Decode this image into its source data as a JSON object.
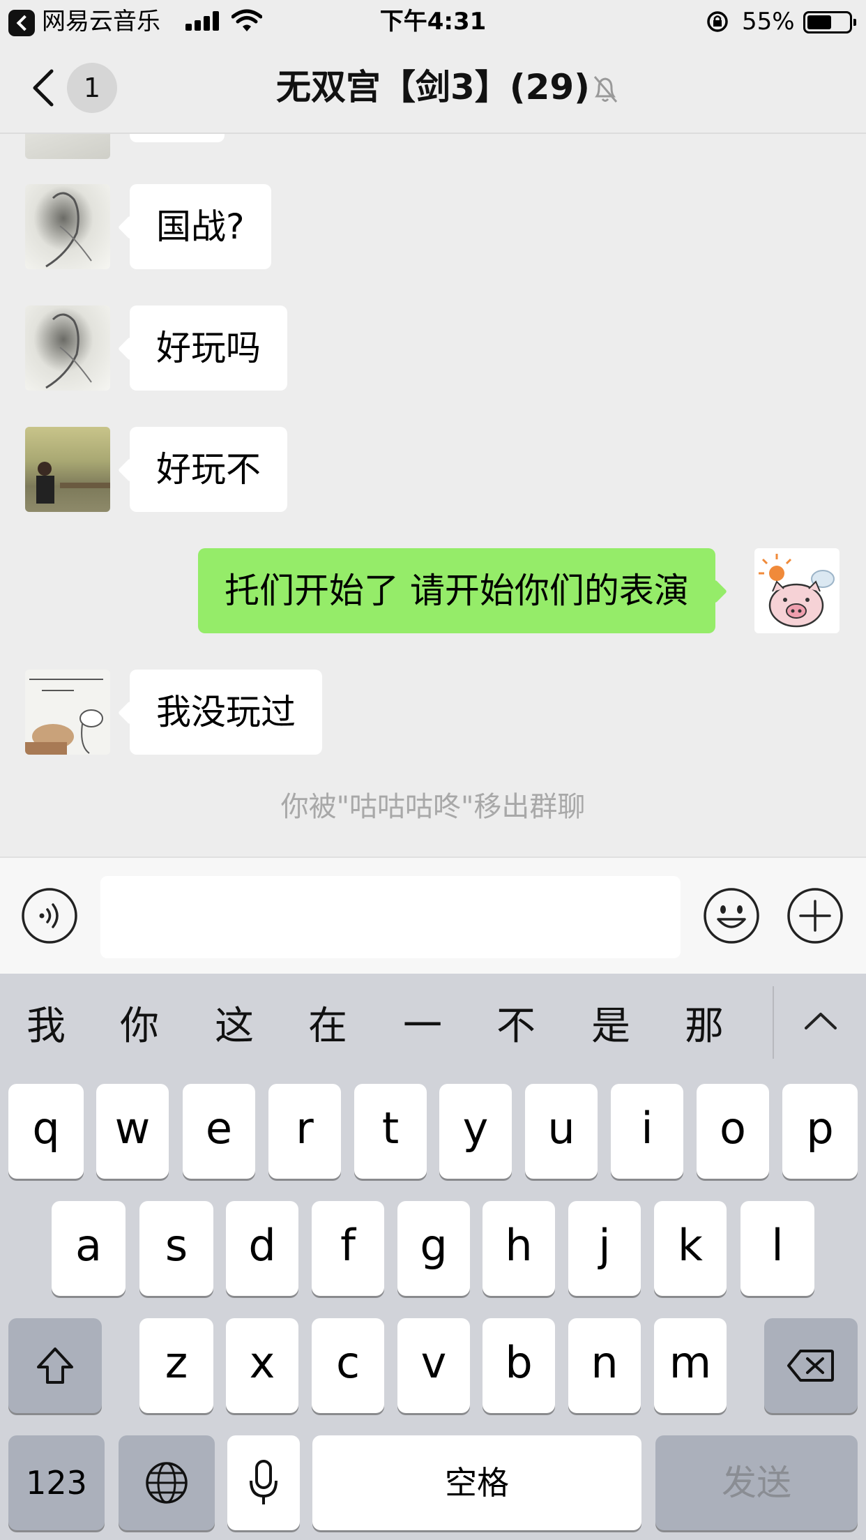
{
  "status_bar": {
    "back_app": "网易云音乐",
    "time": "下午4:31",
    "battery": "55%"
  },
  "nav": {
    "unread_count": "1",
    "title": "无双宫【剑3】(29)"
  },
  "messages": [
    {
      "text": "国战?"
    },
    {
      "text": "好玩吗"
    },
    {
      "text": "好玩不"
    },
    {
      "text": "托们开始了 请开始你们的表演"
    },
    {
      "text": "我没玩过"
    }
  ],
  "system_notice": "你被\"咕咕咕咚\"移出群聊",
  "keyboard": {
    "candidates": [
      "我",
      "你",
      "这",
      "在",
      "一",
      "不",
      "是",
      "那"
    ],
    "row1": [
      "q",
      "w",
      "e",
      "r",
      "t",
      "y",
      "u",
      "i",
      "o",
      "p"
    ],
    "row2": [
      "a",
      "s",
      "d",
      "f",
      "g",
      "h",
      "j",
      "k",
      "l"
    ],
    "row3": [
      "z",
      "x",
      "c",
      "v",
      "b",
      "n",
      "m"
    ],
    "numbers_key": "123",
    "space_key": "空格",
    "send_key": "发送"
  }
}
